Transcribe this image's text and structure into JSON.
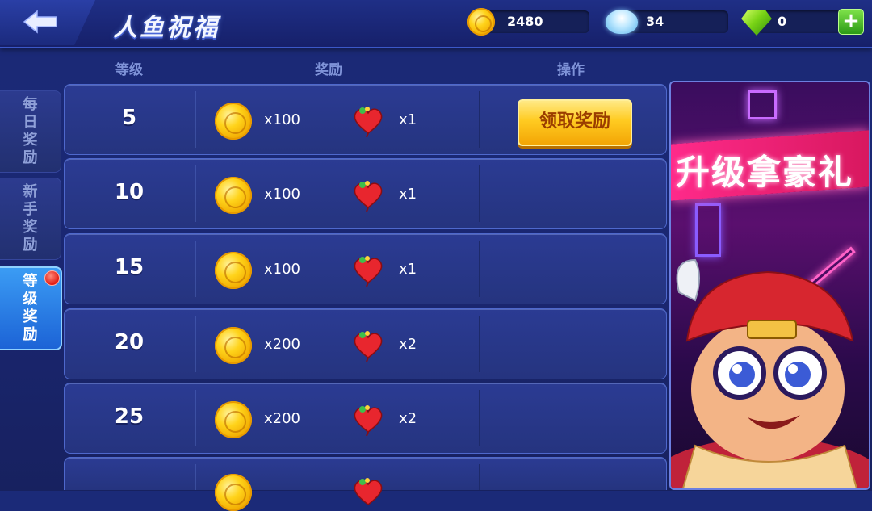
{
  "header": {
    "title": "人鱼祝福",
    "coins": "2480",
    "shells": "34",
    "gems": "0",
    "add_label": "+"
  },
  "sidebar": {
    "tabs": [
      {
        "label": "每日奖励",
        "active": false
      },
      {
        "label": "新手奖励",
        "active": false
      },
      {
        "label": "等级奖励",
        "active": true
      }
    ]
  },
  "table": {
    "columns": [
      "等级",
      "奖励",
      "操作"
    ],
    "claim_label": "领取奖励",
    "rows": [
      {
        "level": "5",
        "coin_qty": "x100",
        "heart_qty": "x1",
        "claimable": true
      },
      {
        "level": "10",
        "coin_qty": "x100",
        "heart_qty": "x1",
        "claimable": false
      },
      {
        "level": "15",
        "coin_qty": "x100",
        "heart_qty": "x1",
        "claimable": false
      },
      {
        "level": "20",
        "coin_qty": "x200",
        "heart_qty": "x2",
        "claimable": false
      },
      {
        "level": "25",
        "coin_qty": "x200",
        "heart_qty": "x2",
        "claimable": false
      }
    ]
  },
  "banner": {
    "text": "升级拿豪礼"
  },
  "colors": {
    "accent": "#3b9cf4",
    "claim_button": "#ffcb21",
    "badge": "#e21b12"
  }
}
